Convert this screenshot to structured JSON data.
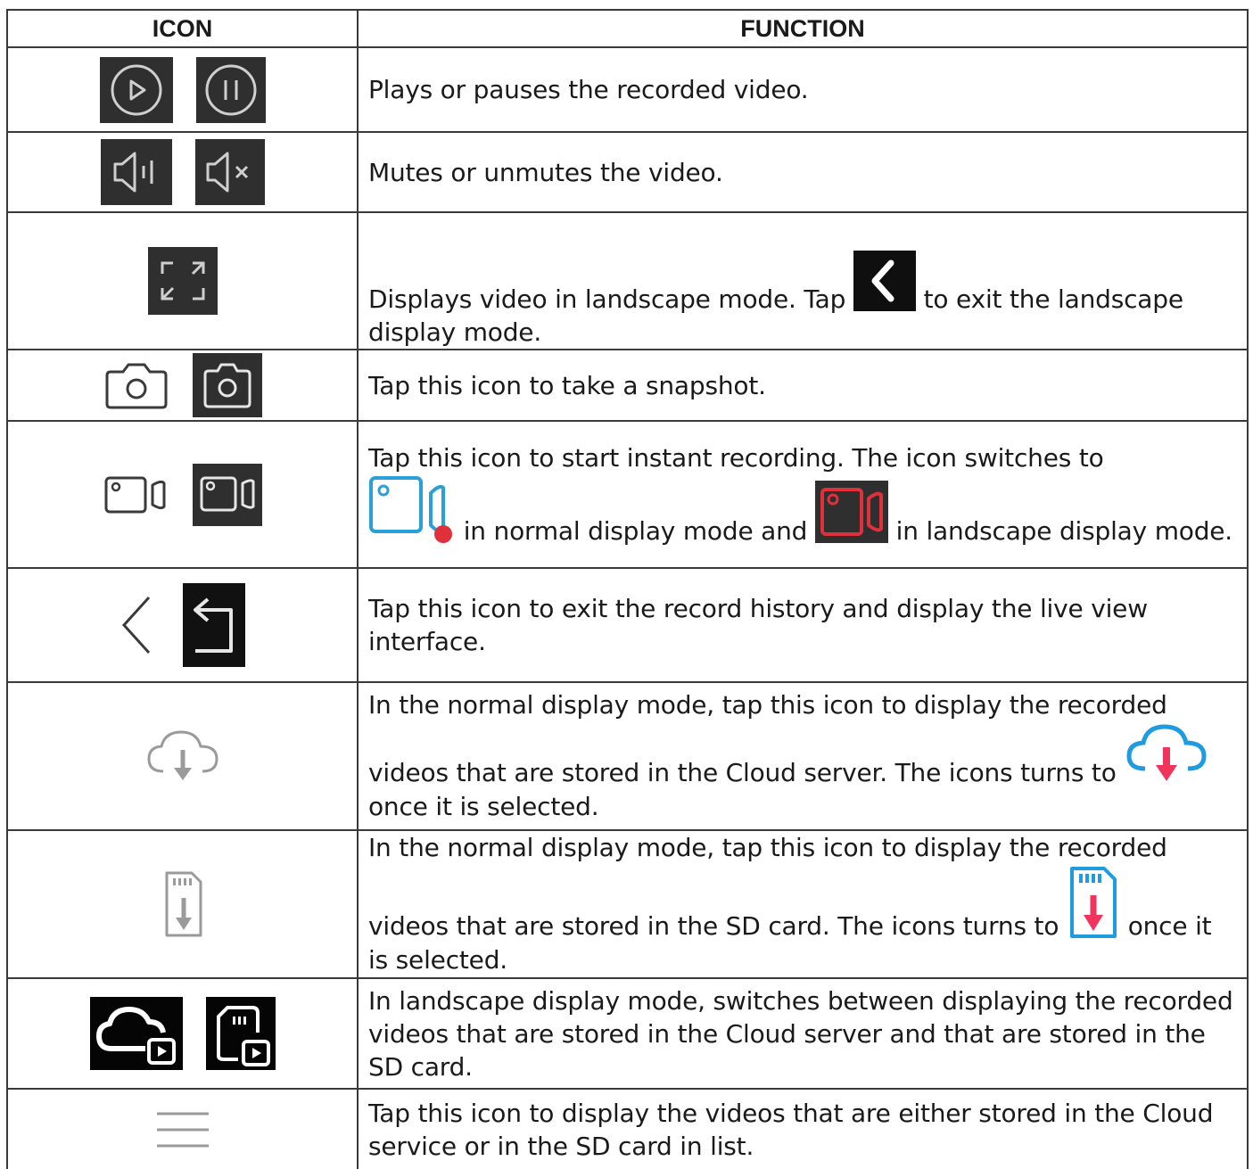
{
  "table": {
    "headers": {
      "icon": "ICON",
      "function": "FUNCTION"
    },
    "rows": [
      {
        "icons": [
          "play-circle-icon",
          "pause-circle-icon"
        ],
        "text": "Plays or pauses the recorded video."
      },
      {
        "icons": [
          "speaker-on-icon",
          "speaker-muted-icon"
        ],
        "text": "Mutes or unmutes the video."
      },
      {
        "icons": [
          "fullscreen-expand-icon"
        ],
        "text_before": "Displays video in landscape mode. Tap",
        "inline_icon": "back-chevron-icon",
        "text_after": "to exit the landscape display mode."
      },
      {
        "icons": [
          "camera-icon",
          "camera-dark-icon"
        ],
        "text": "Tap this icon to take a snapshot."
      },
      {
        "icons": [
          "video-camera-icon",
          "video-camera-dark-icon"
        ],
        "text_before": "Tap this icon to start instant recording. The icon switches to",
        "inline_icon_1": "recording-blue-icon",
        "text_middle": "in normal display mode and",
        "inline_icon_2": "recording-red-icon",
        "text_after": "in landscape display mode."
      },
      {
        "icons": [
          "back-arrow-icon",
          "return-icon"
        ],
        "text": "Tap this icon to exit the record history and display the live view interface."
      },
      {
        "icons": [
          "cloud-download-icon"
        ],
        "text_before": "In the normal display mode, tap this icon to display the recorded videos that are stored in the Cloud server. The icons turns to",
        "inline_icon": "cloud-download-selected-icon",
        "text_after": "once it is selected."
      },
      {
        "icons": [
          "sd-card-download-icon"
        ],
        "text_before": "In the normal display mode, tap this icon to display the recorded videos that are stored in the SD card. The icons turns to",
        "inline_icon": "sd-card-download-selected-icon",
        "text_after": "once it is selected."
      },
      {
        "icons": [
          "cloud-play-icon",
          "sd-card-play-icon"
        ],
        "text": "In landscape display mode, switches between displaying the recorded videos that are stored in the Cloud server and that are stored in the SD card."
      },
      {
        "icons": [
          "list-menu-icon"
        ],
        "text": "Tap this icon to display the videos that are either stored in the Cloud service or in the SD card in list."
      }
    ]
  },
  "colors": {
    "dark_bg": "#2f2f2f",
    "recording_blue": "#2aa0d8",
    "recording_red": "#e0303c",
    "download_pink": "#f0345c",
    "cloud_blue": "#1f9be0"
  }
}
